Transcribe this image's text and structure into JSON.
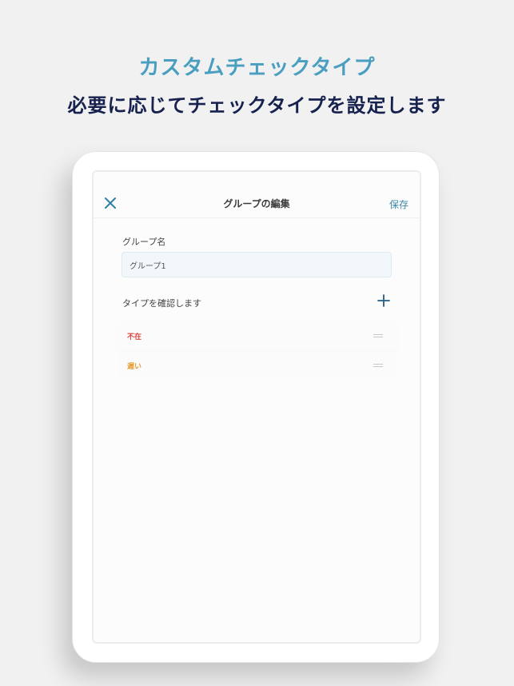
{
  "promo": {
    "title": "カスタムチェックタイプ",
    "subtitle": "必要に応じてチェックタイプを設定します"
  },
  "nav": {
    "title": "グループの編集",
    "save_label": "保存",
    "close_icon": "close-icon"
  },
  "form": {
    "group_name_label": "グループ名",
    "group_name_value": "グループ1",
    "types_label": "タイプを確認します",
    "add_icon": "plus-icon"
  },
  "types": [
    {
      "name": "不在",
      "color": "#e0473e"
    },
    {
      "name": "遅い",
      "color": "#e39b2c"
    }
  ],
  "colors": {
    "background": "#f1f1f2",
    "title": "#4a9fc0",
    "subtitle": "#16214d",
    "accent": "#3b86a8"
  }
}
